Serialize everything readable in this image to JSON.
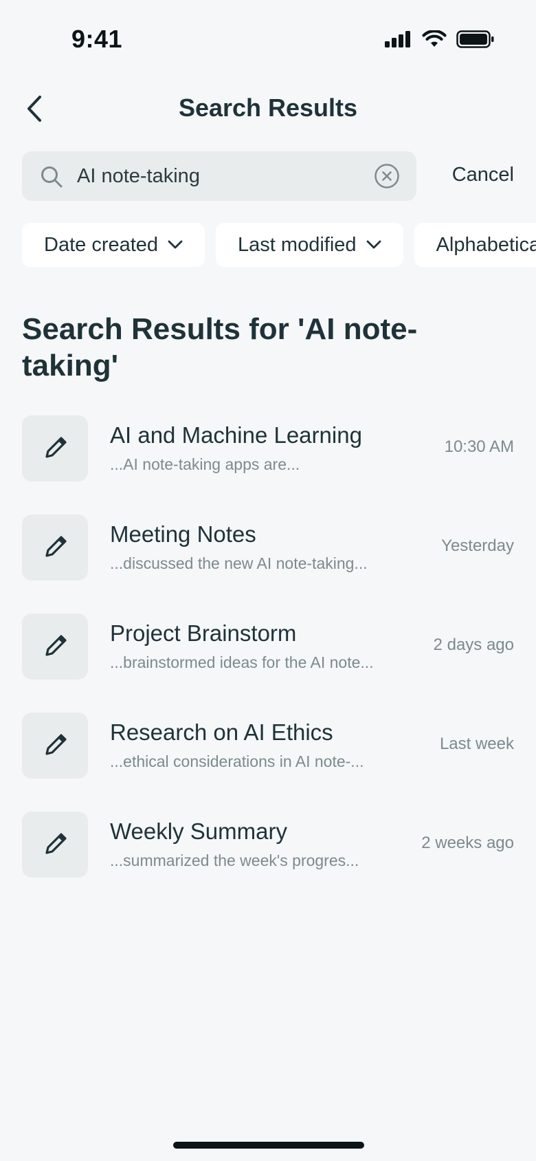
{
  "status_bar": {
    "time": "9:41"
  },
  "header": {
    "title": "Search Results"
  },
  "search": {
    "query": "AI note-taking",
    "cancel_label": "Cancel"
  },
  "filters": [
    {
      "label": "Date created"
    },
    {
      "label": "Last modified"
    },
    {
      "label": "Alphabetical"
    }
  ],
  "results_heading": "Search Results for 'AI note-taking'",
  "results": [
    {
      "title": "AI and Machine Learning",
      "snippet": "...AI note-taking apps are...",
      "time": "10:30 AM"
    },
    {
      "title": "Meeting Notes",
      "snippet": "...discussed the new AI note-taking...",
      "time": "Yesterday"
    },
    {
      "title": "Project Brainstorm",
      "snippet": "...brainstormed ideas for the AI note...",
      "time": "2 days ago"
    },
    {
      "title": "Research on AI Ethics",
      "snippet": "...ethical considerations in AI note-...",
      "time": "Last week"
    },
    {
      "title": "Weekly Summary",
      "snippet": "...summarized the week's progres...",
      "time": "2 weeks ago"
    }
  ],
  "icons": {
    "back": "chevron-left-icon",
    "search": "search-icon",
    "clear": "clear-circle-icon",
    "chip": "chevron-down-icon",
    "item": "pencil-icon"
  },
  "colors": {
    "background": "#f5f7f9",
    "text_primary": "#1f3238",
    "text_secondary": "#7d8a8d",
    "surface": "#e9ecec",
    "chip_bg": "#ffffff"
  }
}
